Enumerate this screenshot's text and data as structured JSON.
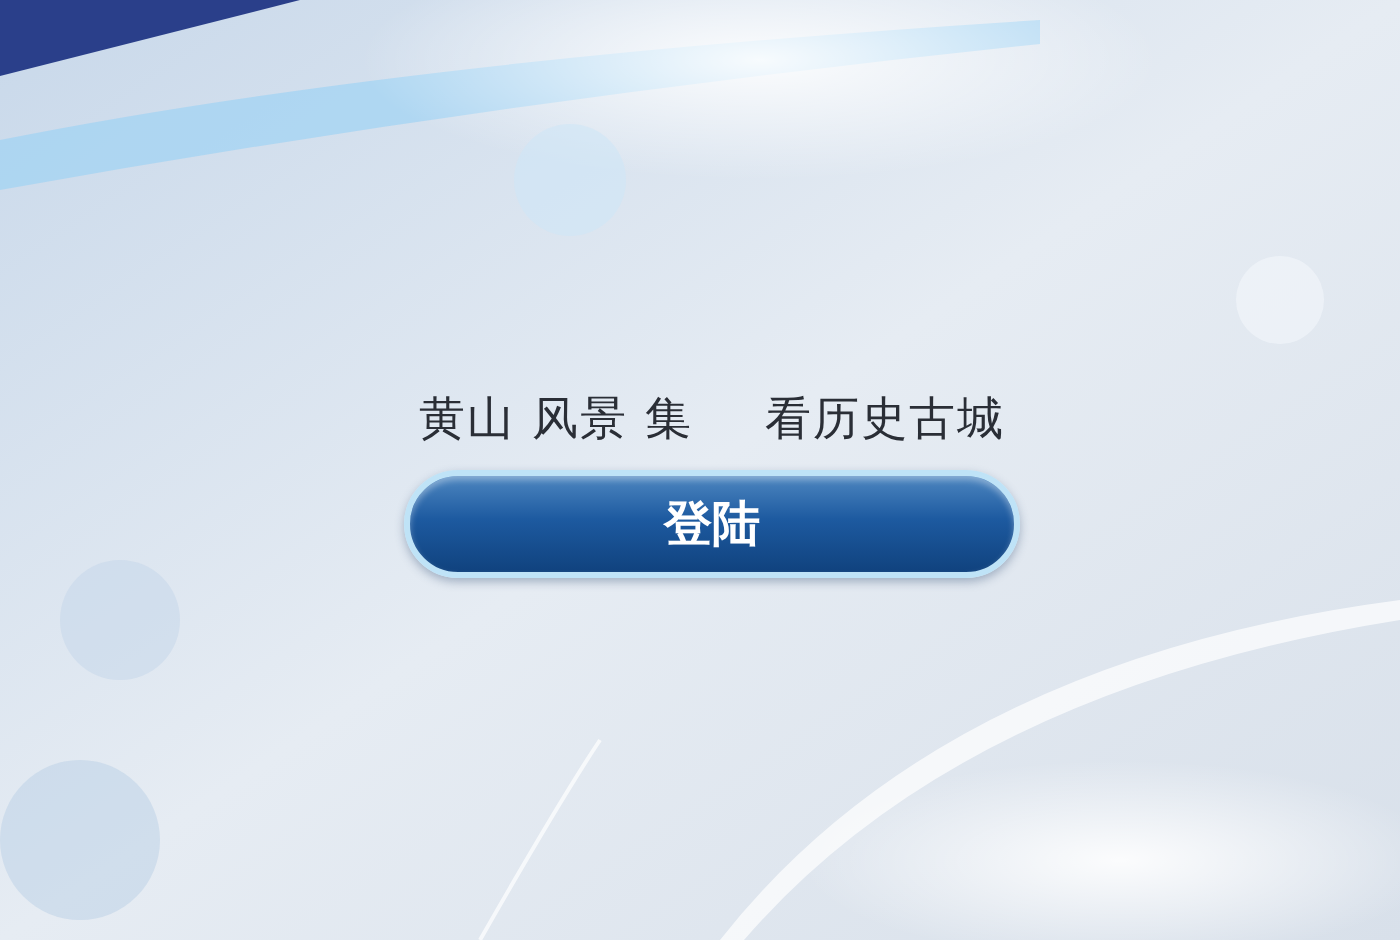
{
  "headline": {
    "parts": [
      "黄山 风景 集",
      "看历史古城"
    ]
  },
  "button": {
    "label": "登陆"
  }
}
